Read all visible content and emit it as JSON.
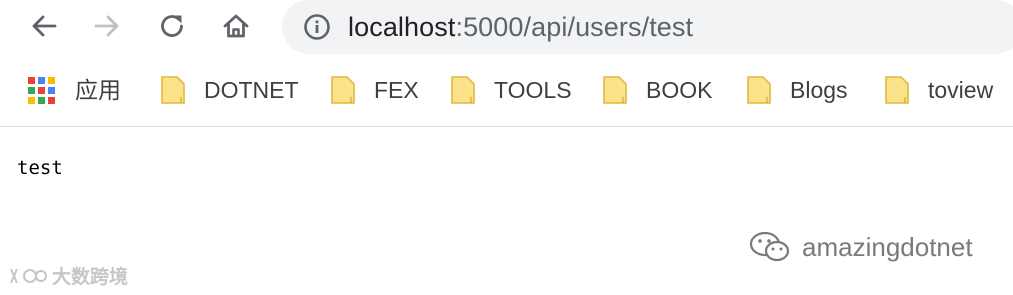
{
  "browser": {
    "url_host": "localhost",
    "url_path": ":5000/api/users/test",
    "back_icon": "arrow-left-icon",
    "forward_icon": "arrow-right-icon",
    "reload_icon": "reload-icon",
    "home_icon": "home-icon",
    "site_info_icon": "info-icon"
  },
  "bookmarks": {
    "apps_label": "应用",
    "items": [
      {
        "label": "DOTNET",
        "icon": "folder-icon"
      },
      {
        "label": "FEX",
        "icon": "folder-icon"
      },
      {
        "label": "TOOLS",
        "icon": "folder-icon"
      },
      {
        "label": "BOOK",
        "icon": "folder-icon"
      },
      {
        "label": "Blogs",
        "icon": "folder-icon"
      },
      {
        "label": "toview",
        "icon": "folder-icon"
      }
    ]
  },
  "page": {
    "body_text": "test"
  },
  "watermarks": {
    "left_text": "大数跨境",
    "right_text": "amazingdotnet"
  },
  "colors": {
    "omnibox_bg": "#f1f3f4",
    "folder_fill": "#fce28a",
    "folder_stroke": "#e0b93a",
    "separator": "#dadce0"
  }
}
